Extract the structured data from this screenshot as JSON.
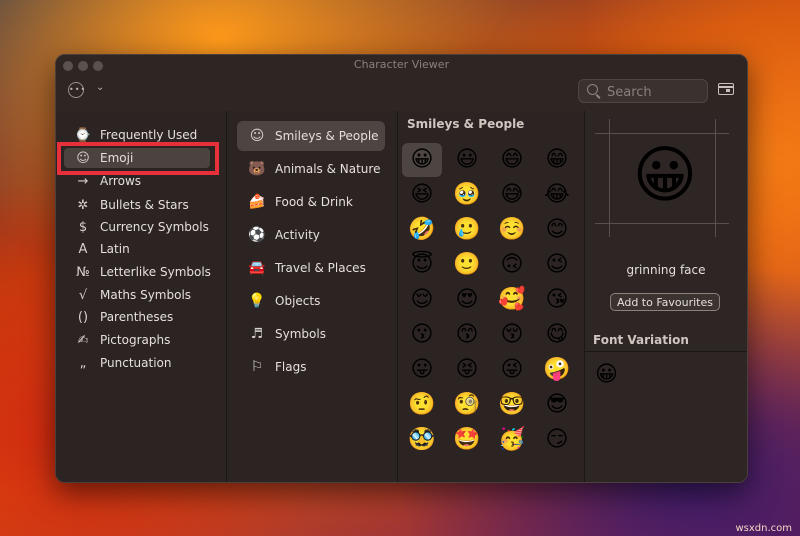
{
  "window": {
    "title": "Character Viewer"
  },
  "toolbar": {
    "more_icon": "ellipsis-circle-icon",
    "search_placeholder": "Search"
  },
  "categories": [
    {
      "label": "Frequently Used",
      "icon": "⌚"
    },
    {
      "label": "Emoji",
      "icon": "☺"
    },
    {
      "label": "Arrows",
      "icon": "→"
    },
    {
      "label": "Bullets & Stars",
      "icon": "✲"
    },
    {
      "label": "Currency Symbols",
      "icon": "$"
    },
    {
      "label": "Latin",
      "icon": "A"
    },
    {
      "label": "Letterlike Symbols",
      "icon": "№"
    },
    {
      "label": "Maths Symbols",
      "icon": "√"
    },
    {
      "label": "Parentheses",
      "icon": "()"
    },
    {
      "label": "Pictographs",
      "icon": "✍"
    },
    {
      "label": "Punctuation",
      "icon": "„"
    }
  ],
  "selected_category": "Emoji",
  "subcategories": [
    {
      "label": "Smileys & People",
      "icon": "☺"
    },
    {
      "label": "Animals & Nature",
      "icon": "🐻"
    },
    {
      "label": "Food & Drink",
      "icon": "🍰"
    },
    {
      "label": "Activity",
      "icon": "⚽"
    },
    {
      "label": "Travel & Places",
      "icon": "🚘"
    },
    {
      "label": "Objects",
      "icon": "💡"
    },
    {
      "label": "Symbols",
      "icon": "♬"
    },
    {
      "label": "Flags",
      "icon": "⚐"
    }
  ],
  "grid": {
    "title": "Smileys & People",
    "emojis": [
      "😀",
      "😃",
      "😄",
      "😁",
      "😆",
      "🥹",
      "😅",
      "😂",
      "🤣",
      "🥲",
      "☺️",
      "😊",
      "😇",
      "🙂",
      "🙃",
      "😉",
      "😌",
      "😍",
      "🥰",
      "😘",
      "😗",
      "😙",
      "😚",
      "😋",
      "😛",
      "😝",
      "😜",
      "🤪",
      "🤨",
      "🧐",
      "🤓",
      "😎",
      "🥸",
      "🤩",
      "🥳",
      "😏"
    ]
  },
  "detail": {
    "emoji": "😀",
    "name": "grinning face",
    "add_label": "Add to Favourites",
    "font_variation_title": "Font Variation",
    "variations": [
      "😀"
    ]
  },
  "credit": "wsxdn.com",
  "colors": {
    "highlight": "#e8303a",
    "selected_bg": "#4d4542",
    "window_bg": "#2b2422"
  }
}
